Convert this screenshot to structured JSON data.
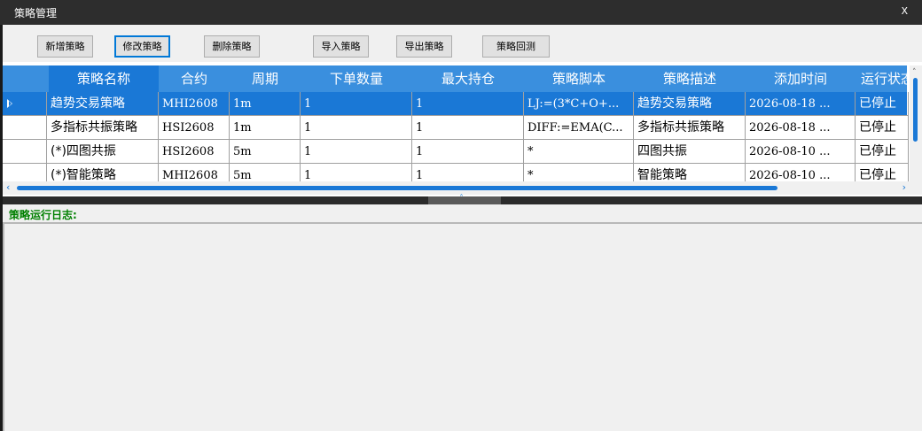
{
  "window": {
    "title": "策略管理",
    "close_label": "X"
  },
  "toolbar": {
    "buttons": [
      {
        "label": "新增策略"
      },
      {
        "label": "修改策略"
      },
      {
        "label": "删除策略"
      },
      {
        "label": "导入策略"
      },
      {
        "label": "导出策略"
      },
      {
        "label": "策略回测"
      }
    ]
  },
  "grid": {
    "columns": [
      "策略名称",
      "合约",
      "周期",
      "下单数量",
      "最大持仓",
      "策略脚本",
      "策略描述",
      "添加时间",
      "运行状态"
    ],
    "rows": [
      {
        "name": "趋势交易策略",
        "contract": "MHI2608",
        "period": "1m",
        "order_qty": "1",
        "max_position": "1",
        "script": "LJ:=(3*C+O+...",
        "description": "趋势交易策略",
        "added": "2026-08-18 ...",
        "status": "已停止"
      },
      {
        "name": "多指标共振策略",
        "contract": "HSI2608",
        "period": "1m",
        "order_qty": "1",
        "max_position": "1",
        "script": "DIFF:=EMA(C...",
        "description": "多指标共振策略",
        "added": "2026-08-18 ...",
        "status": "已停止"
      },
      {
        "name": "(*)四图共振",
        "contract": "HSI2608",
        "period": "5m",
        "order_qty": "1",
        "max_position": "1",
        "script": "*",
        "description": "四图共振",
        "added": "2026-08-10 ...",
        "status": "已停止"
      },
      {
        "name": "(*)智能策略",
        "contract": "MHI2608",
        "period": "5m",
        "order_qty": "1",
        "max_position": "1",
        "script": "*",
        "description": "智能策略",
        "added": "2026-08-10 ...",
        "status": "已停止"
      }
    ],
    "selected_row": 0
  },
  "log": {
    "label": "策略运行日志:"
  },
  "colors": {
    "header": "#3a8fde",
    "selected": "#1a78d6",
    "log_label": "#008000"
  }
}
